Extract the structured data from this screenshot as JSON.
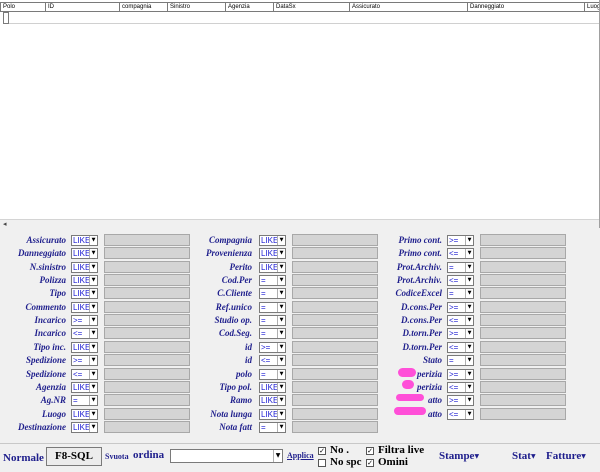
{
  "grid": {
    "columns": [
      "Polo",
      "ID",
      "compagnia",
      "Sinistro",
      "Agenzia",
      "DataSx",
      "Assicurato",
      "Danneggiato",
      "Luog"
    ]
  },
  "filters": {
    "col1": [
      {
        "label": "Assicurato",
        "op": "LIKE"
      },
      {
        "label": "Danneggiato",
        "op": "LIKE"
      },
      {
        "label": "N.sinistro",
        "op": "LIKE"
      },
      {
        "label": "Polizza",
        "op": "LIKE"
      },
      {
        "label": "Tipo",
        "op": "LIKE"
      },
      {
        "label": "Commento",
        "op": "LIKE"
      },
      {
        "label": "Incarico",
        "op": ">="
      },
      {
        "label": "Incarico",
        "op": "<="
      },
      {
        "label": "Tipo inc.",
        "op": "LIKE"
      },
      {
        "label": "Spedizione",
        "op": ">="
      },
      {
        "label": "Spedizione",
        "op": "<="
      },
      {
        "label": "Agenzia",
        "op": "LIKE"
      },
      {
        "label": "Ag.NR",
        "op": "="
      },
      {
        "label": "Luogo",
        "op": "LIKE"
      },
      {
        "label": "Destinazione",
        "op": "LIKE"
      }
    ],
    "col2": [
      {
        "label": "Compagnia",
        "op": "LIKE"
      },
      {
        "label": "Provenienza",
        "op": "LIKE"
      },
      {
        "label": "Perito",
        "op": "LIKE"
      },
      {
        "label": "Cod.Per",
        "op": "="
      },
      {
        "label": "C.Cliente",
        "op": "="
      },
      {
        "label": "Ref.unico",
        "op": "="
      },
      {
        "label": "Studio op.",
        "op": "="
      },
      {
        "label": "Cod.Seg.",
        "op": "="
      },
      {
        "label": "id",
        "op": ">="
      },
      {
        "label": "id",
        "op": "<="
      },
      {
        "label": "polo",
        "op": "="
      },
      {
        "label": "Tipo pol.",
        "op": "LIKE"
      },
      {
        "label": "Ramo",
        "op": "LIKE"
      },
      {
        "label": "Nota lunga",
        "op": "LIKE"
      },
      {
        "label": "Nota fatt",
        "op": "="
      }
    ],
    "col3": [
      {
        "label": "Primo cont.",
        "op": ">="
      },
      {
        "label": "Primo cont.",
        "op": "<="
      },
      {
        "label": "Prot.Archiv.",
        "op": "="
      },
      {
        "label": "Prot.Archiv.",
        "op": "<="
      },
      {
        "label": "CodiceExcel",
        "op": "="
      },
      {
        "label": "D.cons.Per",
        "op": ">="
      },
      {
        "label": "D.cons.Per",
        "op": "<="
      },
      {
        "label": "D.torn.Per",
        "op": ">="
      },
      {
        "label": "D.torn.Per",
        "op": "<="
      },
      {
        "label": "Stato",
        "op": "="
      },
      {
        "label": "perizia",
        "op": ">="
      },
      {
        "label": "perizia",
        "op": "<="
      },
      {
        "label": "atto",
        "op": ">="
      },
      {
        "label": "atto",
        "op": "<="
      }
    ]
  },
  "toolbar": {
    "normale": "Normale",
    "f8": "F8-SQL",
    "svuota": "Svuota",
    "ordina": "ordina",
    "applica": "Applica",
    "no": "No .",
    "no_spc": "No spc",
    "filtra_live": "Filtra live",
    "omini": "Omini",
    "stampe": "Stampe",
    "stat": "Stat",
    "fatture": "Fatture",
    "check_mark": "✓"
  },
  "colors": {
    "label": "#1e1e8c",
    "operator": "#1a1ad2",
    "redaction": "#ff4fd8"
  }
}
